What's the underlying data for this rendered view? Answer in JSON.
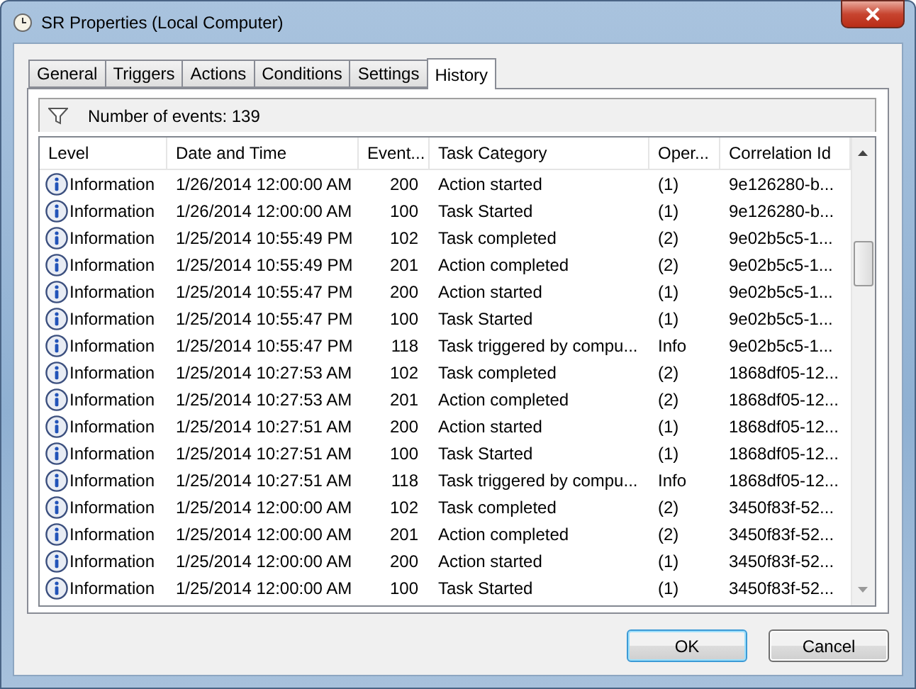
{
  "window": {
    "title": "SR Properties (Local Computer)"
  },
  "tabs": [
    {
      "label": "General",
      "selected": false
    },
    {
      "label": "Triggers",
      "selected": false
    },
    {
      "label": "Actions",
      "selected": false
    },
    {
      "label": "Conditions",
      "selected": false
    },
    {
      "label": "Settings",
      "selected": false
    },
    {
      "label": "History",
      "selected": true
    }
  ],
  "filter_bar": {
    "label": "Number of events: 139"
  },
  "table": {
    "columns": [
      "Level",
      "Date and Time",
      "Event...",
      "Task Category",
      "Oper...",
      "Correlation Id"
    ],
    "rows": [
      [
        "Information",
        "1/26/2014 12:00:00 AM",
        "200",
        "Action started",
        "(1)",
        "9e126280-b..."
      ],
      [
        "Information",
        "1/26/2014 12:00:00 AM",
        "100",
        "Task Started",
        "(1)",
        "9e126280-b..."
      ],
      [
        "Information",
        "1/25/2014 10:55:49 PM",
        "102",
        "Task completed",
        "(2)",
        "9e02b5c5-1..."
      ],
      [
        "Information",
        "1/25/2014 10:55:49 PM",
        "201",
        "Action completed",
        "(2)",
        "9e02b5c5-1..."
      ],
      [
        "Information",
        "1/25/2014 10:55:47 PM",
        "200",
        "Action started",
        "(1)",
        "9e02b5c5-1..."
      ],
      [
        "Information",
        "1/25/2014 10:55:47 PM",
        "100",
        "Task Started",
        "(1)",
        "9e02b5c5-1..."
      ],
      [
        "Information",
        "1/25/2014 10:55:47 PM",
        "118",
        "Task triggered by compu...",
        "Info",
        "9e02b5c5-1..."
      ],
      [
        "Information",
        "1/25/2014 10:27:53 AM",
        "102",
        "Task completed",
        "(2)",
        "1868df05-12..."
      ],
      [
        "Information",
        "1/25/2014 10:27:53 AM",
        "201",
        "Action completed",
        "(2)",
        "1868df05-12..."
      ],
      [
        "Information",
        "1/25/2014 10:27:51 AM",
        "200",
        "Action started",
        "(1)",
        "1868df05-12..."
      ],
      [
        "Information",
        "1/25/2014 10:27:51 AM",
        "100",
        "Task Started",
        "(1)",
        "1868df05-12..."
      ],
      [
        "Information",
        "1/25/2014 10:27:51 AM",
        "118",
        "Task triggered by compu...",
        "Info",
        "1868df05-12..."
      ],
      [
        "Information",
        "1/25/2014 12:00:00 AM",
        "102",
        "Task completed",
        "(2)",
        "3450f83f-52..."
      ],
      [
        "Information",
        "1/25/2014 12:00:00 AM",
        "201",
        "Action completed",
        "(2)",
        "3450f83f-52..."
      ],
      [
        "Information",
        "1/25/2014 12:00:00 AM",
        "200",
        "Action started",
        "(1)",
        "3450f83f-52..."
      ],
      [
        "Information",
        "1/25/2014 12:00:00 AM",
        "100",
        "Task Started",
        "(1)",
        "3450f83f-52..."
      ]
    ]
  },
  "buttons": [
    {
      "label": "OK",
      "kind": "default"
    },
    {
      "label": "Cancel",
      "kind": "normal"
    }
  ]
}
